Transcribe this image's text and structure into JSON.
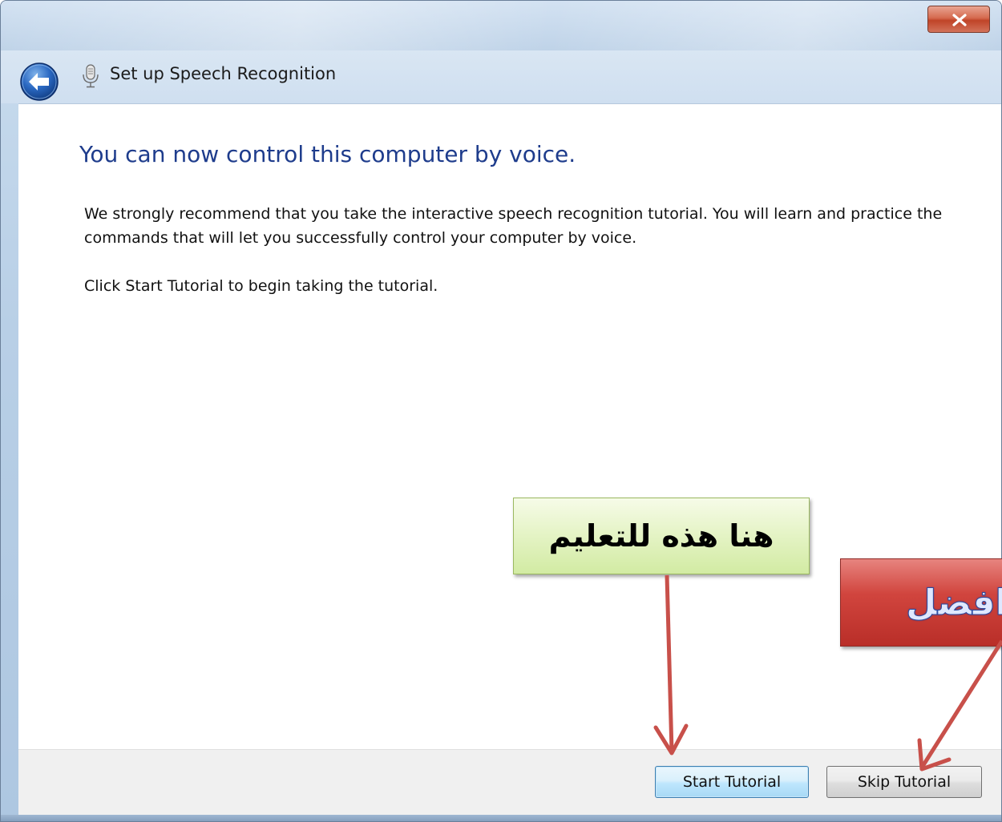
{
  "window": {
    "title": "Set up Speech Recognition"
  },
  "icons": {
    "back": "back-arrow-icon",
    "app": "microphone-icon",
    "close": "close-icon"
  },
  "content": {
    "heading": "You can now control this computer by voice.",
    "paragraph1": "We strongly recommend that you take the interactive speech recognition tutorial. You will learn and practice the commands that will let you successfully control your computer by voice.",
    "paragraph2": "Click Start Tutorial to begin taking the tutorial."
  },
  "buttons": {
    "start_tutorial": "Start Tutorial",
    "skip_tutorial": "Skip Tutorial"
  },
  "annotations": {
    "green_label": "هنا هذه للتعليم",
    "red_label": "ا افضل"
  },
  "colors": {
    "heading": "#1e3c8c",
    "arrow": "#c8504a",
    "annotation_green": "#e4f3c4",
    "annotation_red": "#d1453e"
  }
}
